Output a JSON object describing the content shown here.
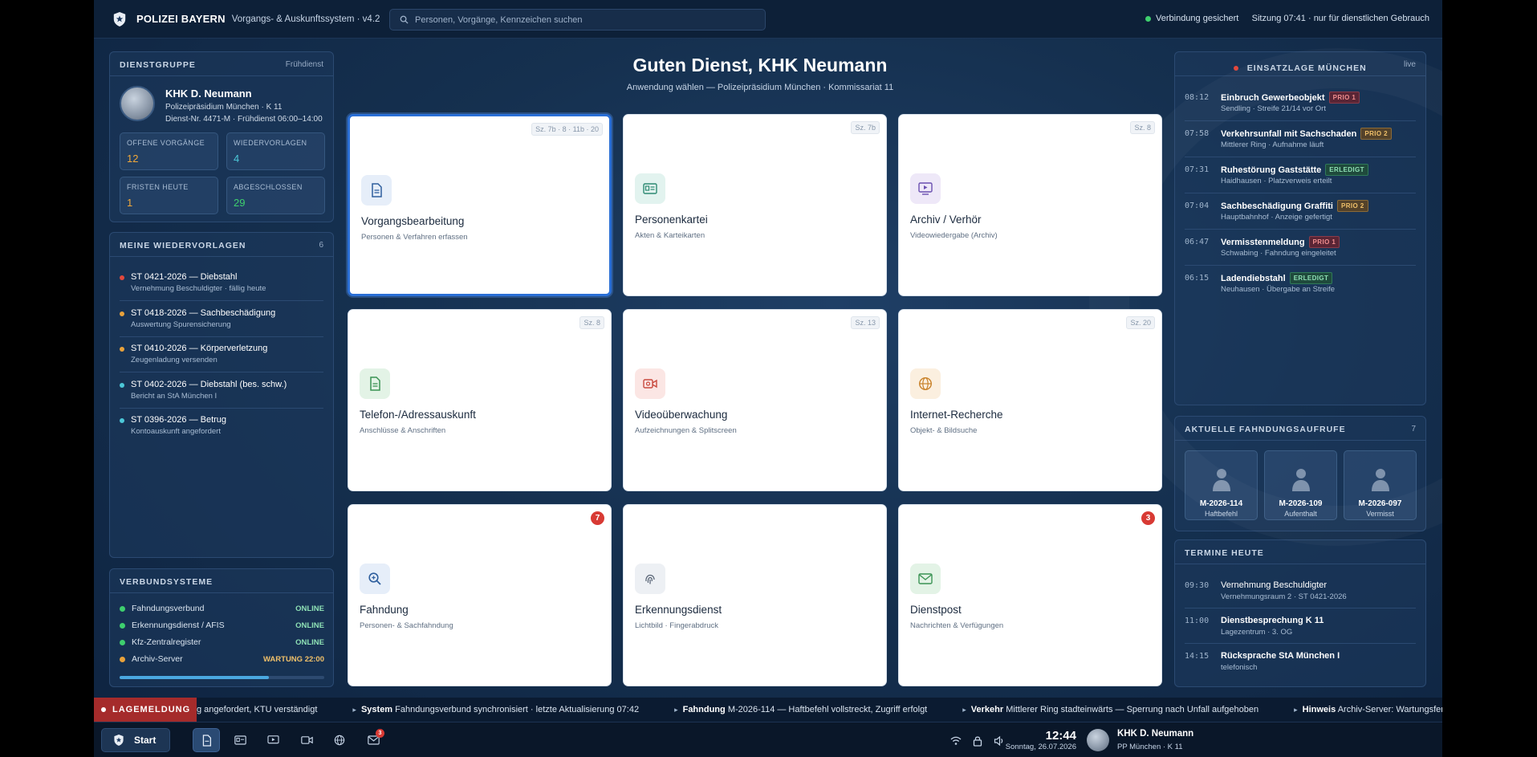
{
  "topbar": {
    "brand": "POLIZEI BAYERN",
    "subtitle": "Vorgangs- & Auskunftssystem · v4.2",
    "search_placeholder": "Personen, Vorgänge, Kennzeichen suchen",
    "connection": "Verbindung gesichert",
    "session": "Sitzung 07:41 · nur für dienstlichen Gebrauch"
  },
  "dienstgruppe": {
    "title": "DIENSTGRUPPE",
    "shift": "Frühdienst",
    "name": "KHK D. Neumann",
    "line1": "Polizeipräsidium München · K 11",
    "line2": "Dienst-Nr. 4471-M · Frühdienst 06:00–14:00",
    "stats": [
      {
        "label": "OFFENE VORGÄNGE",
        "value": "12",
        "color": "#f0a83a"
      },
      {
        "label": "WIEDERVORLAGEN",
        "value": "4",
        "color": "#4cc8d8"
      },
      {
        "label": "FRISTEN HEUTE",
        "value": "1",
        "color": "#f0a83a"
      },
      {
        "label": "ABGESCHLOSSEN",
        "value": "29",
        "color": "#3ecf6e"
      }
    ]
  },
  "wiedervorlagen": {
    "title": "MEINE WIEDERVORLAGEN",
    "count": "6",
    "items": [
      {
        "title": "ST 0421-2026 — Diebstahl",
        "desc": "Vernehmung Beschuldigter · fällig heute",
        "color": "#e2483d"
      },
      {
        "title": "ST 0418-2026 — Sachbeschädigung",
        "desc": "Auswertung Spurensicherung",
        "color": "#e9a23b"
      },
      {
        "title": "ST 0410-2026 — Körperverletzung",
        "desc": "Zeugenladung versenden",
        "color": "#e9a23b"
      },
      {
        "title": "ST 0402-2026 — Diebstahl (bes. schw.)",
        "desc": "Bericht an StA München I",
        "color": "#4cc8d8"
      },
      {
        "title": "ST 0396-2026 — Betrug",
        "desc": "Kontoauskunft angefordert",
        "color": "#4cc8d8"
      }
    ]
  },
  "verbund": {
    "title": "VERBUNDSYSTEME",
    "rows": [
      {
        "name": "Fahndungsverbund",
        "status": "ONLINE",
        "color": "#3ecf6e",
        "scolor": "#8ee0b5"
      },
      {
        "name": "Erkennungsdienst / AFIS",
        "status": "ONLINE",
        "color": "#3ecf6e",
        "scolor": "#8ee0b5"
      },
      {
        "name": "Kfz-Zentralregister",
        "status": "ONLINE",
        "color": "#3ecf6e",
        "scolor": "#8ee0b5"
      },
      {
        "name": "Archiv-Server",
        "status": "WARTUNG 22:00",
        "color": "#e9a23b",
        "scolor": "#f0c06a"
      }
    ],
    "load_fraction": 0.73
  },
  "main": {
    "greeting": "Guten Dienst, KHK Neumann",
    "subtitle": "Anwendung wählen — Polizeipräsidium München · Kommissariat 11",
    "cards": [
      {
        "title": "Vorgangsbearbeitung",
        "sub": "Personen & Verfahren erfassen",
        "tag": "Sz. 7b · 8 · 11b · 20",
        "icon": "document-icon",
        "bg": "#e6eef9",
        "fg": "#2f5f9e"
      },
      {
        "title": "Personenkartei",
        "sub": "Akten & Karteikarten",
        "tag": "Sz. 7b",
        "icon": "id-card-icon",
        "bg": "#e2f3ef",
        "fg": "#2d8a73"
      },
      {
        "title": "Archiv / Verhör",
        "sub": "Videowiedergabe (Archiv)",
        "tag": "Sz. 8",
        "icon": "video-play-icon",
        "bg": "#eee8f8",
        "fg": "#6a4fb0"
      },
      {
        "title": "Telefon-/Adressauskunft",
        "sub": "Anschlüsse & Anschriften",
        "tag": "Sz. 8",
        "icon": "address-document-icon",
        "bg": "#e3f3e6",
        "fg": "#3b9354"
      },
      {
        "title": "Videoüberwachung",
        "sub": "Aufzeichnungen & Splitscreen",
        "tag": "Sz. 13",
        "icon": "camera-icon",
        "bg": "#fbe6e4",
        "fg": "#c94a3e"
      },
      {
        "title": "Internet-Recherche",
        "sub": "Objekt- & Bildsuche",
        "tag": "Sz. 20",
        "icon": "globe-icon",
        "bg": "#fbefdf",
        "fg": "#c9822a"
      },
      {
        "title": "Fahndung",
        "sub": "Personen- & Sachfahndung",
        "badge": "7",
        "icon": "magnifier-icon",
        "bg": "#e6eef9",
        "fg": "#2f5f9e"
      },
      {
        "title": "Erkennungsdienst",
        "sub": "Lichtbild · Fingerabdruck",
        "icon": "fingerprint-icon",
        "bg": "#edf0f4",
        "fg": "#5b6778"
      },
      {
        "title": "Dienstpost",
        "sub": "Nachrichten & Verfügungen",
        "badge": "3",
        "icon": "mail-icon",
        "bg": "#e3f3e6",
        "fg": "#3b9354"
      }
    ]
  },
  "einsatz": {
    "title": "EINSATZLAGE MÜNCHEN",
    "live": "live",
    "events": [
      {
        "time": "08:12",
        "title": "Einbruch Gewerbeobjekt",
        "badge": "PRIO 1",
        "kind": "b-red",
        "desc": "Sendling · Streife 21/14 vor Ort"
      },
      {
        "time": "07:58",
        "title": "Verkehrsunfall mit Sachschaden",
        "badge": "PRIO 2",
        "kind": "b-orange",
        "desc": "Mittlerer Ring · Aufnahme läuft"
      },
      {
        "time": "07:31",
        "title": "Ruhestörung Gaststätte",
        "badge": "ERLEDIGT",
        "kind": "b-green",
        "desc": "Haidhausen · Platzverweis erteilt"
      },
      {
        "time": "07:04",
        "title": "Sachbeschädigung Graffiti",
        "badge": "PRIO 2",
        "kind": "b-orange",
        "desc": "Hauptbahnhof · Anzeige gefertigt"
      },
      {
        "time": "06:47",
        "title": "Vermisstenmeldung",
        "badge": "PRIO 1",
        "kind": "b-red",
        "desc": "Schwabing · Fahndung eingeleitet"
      },
      {
        "time": "06:15",
        "title": "Ladendiebstahl",
        "badge": "ERLEDIGT",
        "kind": "b-green",
        "desc": "Neuhausen · Übergabe an Streife"
      }
    ]
  },
  "fahndung": {
    "title": "AKTUELLE FAHNDUNGSAUFRUFE",
    "count": "7",
    "items": [
      {
        "id": "M-2026-114",
        "kind": "Haftbefehl"
      },
      {
        "id": "M-2026-109",
        "kind": "Aufenthalt"
      },
      {
        "id": "M-2026-097",
        "kind": "Vermisst"
      }
    ]
  },
  "termine": {
    "title": "TERMINE HEUTE",
    "items": [
      {
        "time": "09:30",
        "title": "Vernehmung Beschuldigter",
        "desc": "Vernehmungsraum 2 · ST 0421-2026"
      },
      {
        "time": "11:00",
        "title": "Dienstbesprechung K 11",
        "desc": "Lagezentrum · 3. OG"
      },
      {
        "time": "14:15",
        "title": "Rücksprache StA München I",
        "desc": "telefonisch"
      }
    ]
  },
  "ticker": {
    "label": "LAGEMELDUNG",
    "items": [
      {
        "cat": "",
        "text": "g angefordert, KTU verständigt"
      },
      {
        "cat": "System",
        "text": "Fahndungsverbund synchronisiert · letzte Aktualisierung 07:42"
      },
      {
        "cat": "Fahndung",
        "text": "M-2026-114 — Haftbefehl vollstreckt, Zugriff erfolgt"
      },
      {
        "cat": "Verkehr",
        "text": "Mittlerer Ring stadteinwärts — Sperrung nach Unfall aufgehoben"
      },
      {
        "cat": "Hinweis",
        "text": "Archiv-Server: Wartungsfenster"
      }
    ]
  },
  "taskbar": {
    "start": "Start",
    "mail_badge": "3",
    "clock": "12:44",
    "date": "Sonntag, 26.07.2026",
    "user": "KHK D. Neumann",
    "unit": "PP München · K 11"
  }
}
